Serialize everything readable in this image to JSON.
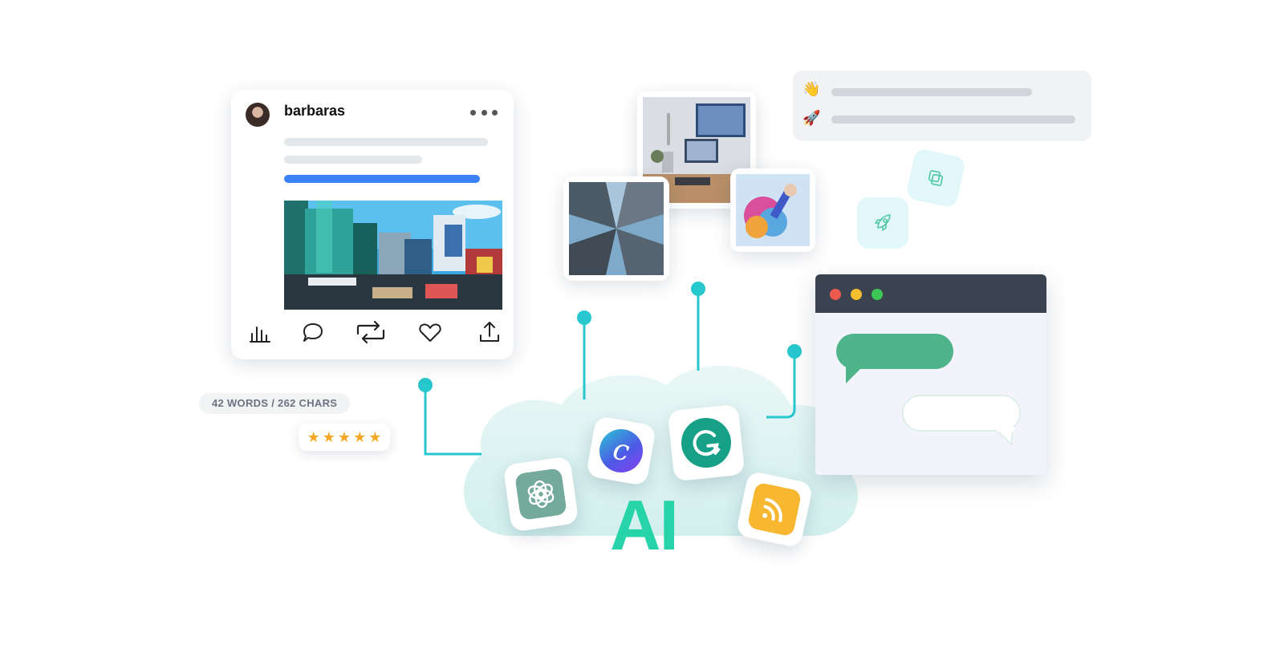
{
  "post": {
    "username": "barbaras",
    "stats": "42 WORDS / 262 CHARS",
    "rating_stars": [
      "★",
      "★",
      "★",
      "★",
      "★"
    ],
    "rating_value": 5,
    "action_icons": [
      "analytics-icon",
      "comment-icon",
      "repost-icon",
      "like-icon",
      "share-icon"
    ]
  },
  "reactions": {
    "emojis": [
      "👋",
      "🚀"
    ]
  },
  "ai": {
    "label": "AI",
    "apps": [
      "chatgpt-icon",
      "canva-icon",
      "grammarly-icon",
      "rss-icon"
    ]
  },
  "colors": {
    "accent_teal": "#27c7cf",
    "ai_green": "#27d3a8",
    "link_blue": "#3b82f6",
    "chat_green": "#4fb48a",
    "browser_dark": "#3b4250",
    "star": "#f5a623"
  }
}
